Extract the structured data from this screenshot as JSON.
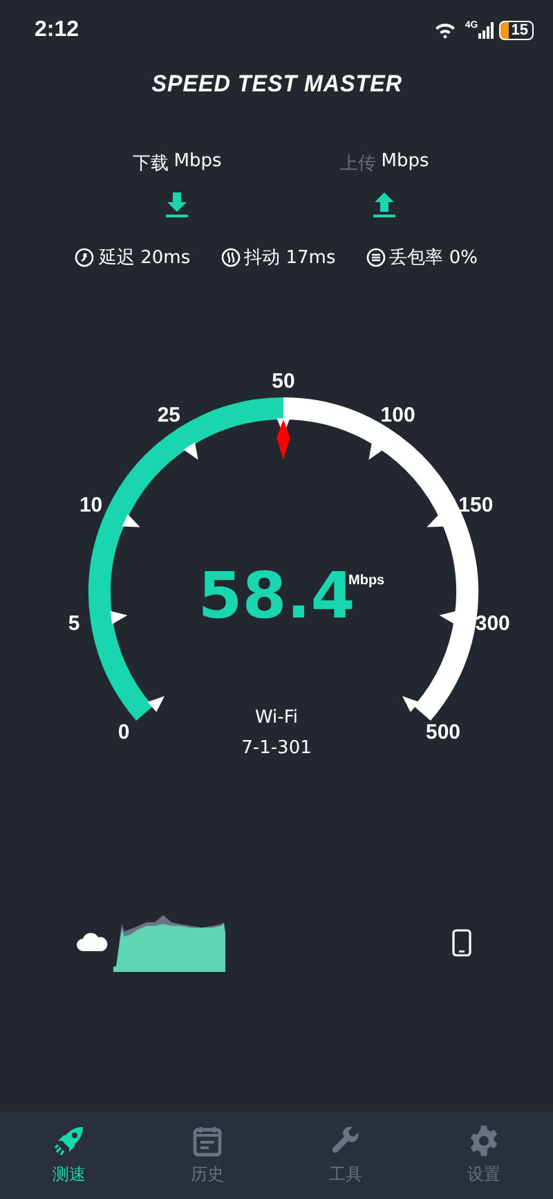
{
  "status_bar": {
    "time": "2:12",
    "network": "4G",
    "battery": "15"
  },
  "app_title": "SPEED TEST MASTER",
  "directions": [
    {
      "kind": "download",
      "label": "下载",
      "unit": "Mbps",
      "selected": true
    },
    {
      "kind": "upload",
      "label": "上传",
      "unit": "Mbps",
      "selected": false
    }
  ],
  "metrics": [
    {
      "kind": "latency",
      "text": "延迟 20ms"
    },
    {
      "kind": "jitter",
      "text": "抖动 17ms"
    },
    {
      "kind": "loss",
      "text": "丢包率 0%"
    }
  ],
  "gauge": {
    "scale_labels": [
      "0",
      "5",
      "10",
      "25",
      "50",
      "100",
      "150",
      "300",
      "500"
    ],
    "value": "58.4",
    "unit": "Mbps",
    "network": "Wi-Fi",
    "ssid": "7-1-301"
  },
  "tabs": [
    {
      "kind": "speed",
      "label": "测速",
      "selected": true
    },
    {
      "kind": "history",
      "label": "历史",
      "selected": false
    },
    {
      "kind": "tools",
      "label": "工具",
      "selected": false
    },
    {
      "kind": "settings",
      "label": "设置",
      "selected": false
    }
  ]
}
